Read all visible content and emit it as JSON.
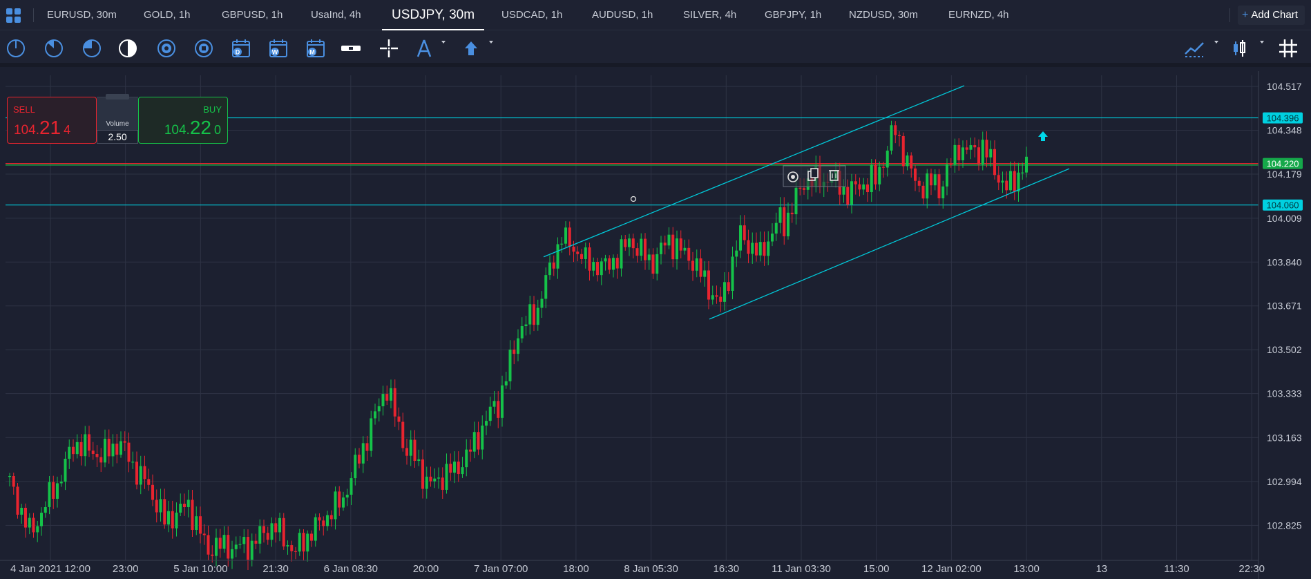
{
  "tabs": [
    {
      "label": "EURUSD, 30m"
    },
    {
      "label": "GOLD, 1h"
    },
    {
      "label": "GBPUSD, 1h"
    },
    {
      "label": "UsaInd, 4h"
    },
    {
      "label": "USDJPY, 30m"
    },
    {
      "label": "USDCAD, 1h"
    },
    {
      "label": "AUDUSD, 1h"
    },
    {
      "label": "SILVER, 4h"
    },
    {
      "label": "GBPJPY, 1h"
    },
    {
      "label": "NZDUSD, 30m"
    },
    {
      "label": "EURNZD, 4h"
    }
  ],
  "active_tab": "USDJPY, 30m",
  "add_chart": {
    "plus": "+",
    "label": "Add Chart"
  },
  "toolbar": {
    "icons": [
      "timeframe-1-icon",
      "timeframe-2-icon",
      "timeframe-3-icon",
      "contrast-icon",
      "indicator-1h-icon",
      "indicator-4h-icon",
      "calendar-day-icon",
      "calendar-week-icon",
      "calendar-month-icon",
      "spread-icon",
      "crosshair-icon",
      "drawing-tool-icon",
      "arrow-up-icon",
      "line-chart-icon",
      "candle-chart-icon",
      "grid-icon"
    ],
    "calendar_letters": {
      "day": "D",
      "week": "W",
      "month": "M"
    }
  },
  "trade": {
    "sell_label": "SELL",
    "sell_price": {
      "prefix": "104.",
      "big": "21",
      "pip": "4"
    },
    "buy_label": "BUY",
    "buy_price": {
      "prefix": "104.",
      "big": "22",
      "pip": "0"
    },
    "volume_label": "Volume",
    "volume_value": "2.50"
  },
  "chart_data": {
    "type": "candlestick",
    "symbol": "USDJPY, 30m",
    "price_ticks": [
      "104.517",
      "104.348",
      "104.179",
      "104.009",
      "103.840",
      "103.671",
      "103.502",
      "103.333",
      "103.163",
      "102.994",
      "102.825"
    ],
    "time_ticks": [
      "4 Jan 2021 12:00",
      "23:00",
      "5 Jan 10:00",
      "21:30",
      "6 Jan 08:30",
      "20:00",
      "7 Jan 07:00",
      "18:00",
      "8 Jan 05:30",
      "16:30",
      "11 Jan 03:30",
      "15:00",
      "12 Jan 02:00",
      "13:00",
      "13",
      "11:30",
      "22:30"
    ],
    "ylim": [
      102.69,
      104.56
    ],
    "price_markers": [
      {
        "value": "104.396",
        "color": "#00d0e0"
      },
      {
        "value": "104.220",
        "color": "#15a84a"
      },
      {
        "value": "104.060",
        "color": "#00d0e0"
      }
    ],
    "horizontal_lines": [
      {
        "price": 104.396,
        "color": "#00c8d8"
      },
      {
        "price": 104.06,
        "color": "#00c8d8"
      },
      {
        "price": 104.22,
        "color": "#e8242f"
      },
      {
        "price": 104.214,
        "color": "#15c249"
      }
    ],
    "trend_lines": [
      {
        "from": {
          "x": "7 Jan 13:00",
          "y": 103.86
        },
        "to": {
          "x": "12 Jan 05:00",
          "y": 104.52
        }
      },
      {
        "from": {
          "x": "8 Jan 14:30",
          "y": 103.62
        },
        "to": {
          "x": "12 Jan 15:30",
          "y": 104.2
        }
      }
    ],
    "up_color": "#15c249",
    "down_color": "#e8242f",
    "grid": true,
    "segments": [
      [
        102.99,
        102.99
      ],
      [
        102.8,
        102.78
      ],
      [
        102.95,
        102.97
      ],
      [
        103.14,
        103.16
      ],
      [
        103.08,
        103.1
      ],
      [
        103.14,
        103.15
      ],
      [
        103.02,
        103.0
      ],
      [
        102.84,
        102.85
      ],
      [
        102.92,
        102.9
      ],
      [
        102.75,
        102.72
      ],
      [
        102.74,
        102.74
      ],
      [
        102.76,
        102.75
      ],
      [
        102.82,
        102.83
      ],
      [
        102.74,
        102.71
      ],
      [
        102.83,
        102.83
      ],
      [
        102.91,
        102.92
      ],
      [
        103.12,
        103.13
      ],
      [
        103.37,
        103.36
      ],
      [
        103.14,
        103.1
      ],
      [
        102.98,
        102.97
      ],
      [
        103.02,
        103.04
      ],
      [
        103.14,
        103.13
      ],
      [
        103.26,
        103.3
      ],
      [
        103.57,
        103.56
      ],
      [
        103.7,
        103.67
      ],
      [
        103.93,
        103.95
      ],
      [
        103.84,
        103.86
      ],
      [
        103.82,
        103.82
      ],
      [
        103.93,
        103.91
      ],
      [
        103.83,
        103.84
      ],
      [
        103.91,
        103.95
      ],
      [
        103.83,
        103.84
      ],
      [
        103.63,
        103.69
      ],
      [
        103.95,
        103.93
      ],
      [
        103.88,
        103.86
      ],
      [
        103.98,
        104.03
      ],
      [
        104.16,
        104.16
      ],
      [
        104.17,
        104.15
      ],
      [
        104.11,
        104.1
      ],
      [
        104.11,
        104.16
      ],
      [
        104.36,
        104.35
      ],
      [
        104.13,
        104.14
      ],
      [
        104.11,
        104.15
      ],
      [
        104.27,
        104.3
      ],
      [
        104.29,
        104.27
      ],
      [
        104.11,
        104.13
      ],
      [
        104.22,
        104.22
      ]
    ]
  }
}
